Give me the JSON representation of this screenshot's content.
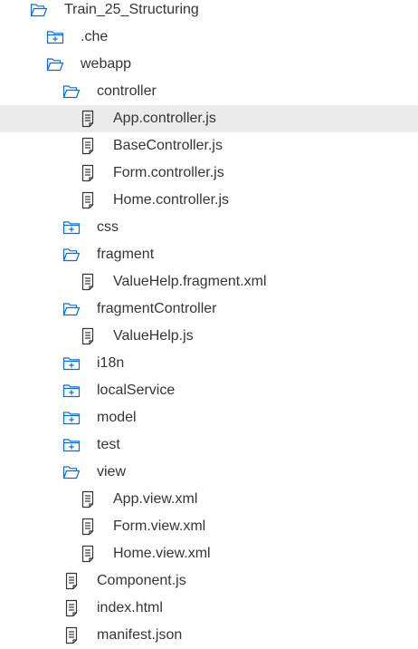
{
  "colors": {
    "icon": "#0a6ed1",
    "file_icon": "#32363a",
    "text": "#32363a",
    "selected_background": "#ebebeb"
  },
  "tree": [
    {
      "label": "Train_25_Structuring",
      "level": 0,
      "icon": "folder-open-icon"
    },
    {
      "label": ".che",
      "level": 1,
      "icon": "folder-closed-icon"
    },
    {
      "label": "webapp",
      "level": 1,
      "icon": "folder-open-icon"
    },
    {
      "label": "controller",
      "level": 2,
      "icon": "folder-open-icon"
    },
    {
      "label": "App.controller.js",
      "level": 3,
      "icon": "file-icon",
      "selected": true
    },
    {
      "label": "BaseController.js",
      "level": 3,
      "icon": "file-icon"
    },
    {
      "label": "Form.controller.js",
      "level": 3,
      "icon": "file-icon"
    },
    {
      "label": "Home.controller.js",
      "level": 3,
      "icon": "file-icon"
    },
    {
      "label": "css",
      "level": 2,
      "icon": "folder-closed-icon"
    },
    {
      "label": "fragment",
      "level": 2,
      "icon": "folder-open-icon"
    },
    {
      "label": "ValueHelp.fragment.xml",
      "level": 3,
      "icon": "file-icon"
    },
    {
      "label": "fragmentController",
      "level": 2,
      "icon": "folder-open-icon"
    },
    {
      "label": "ValueHelp.js",
      "level": 3,
      "icon": "file-icon"
    },
    {
      "label": "i18n",
      "level": 2,
      "icon": "folder-closed-icon"
    },
    {
      "label": "localService",
      "level": 2,
      "icon": "folder-closed-icon"
    },
    {
      "label": "model",
      "level": 2,
      "icon": "folder-closed-icon"
    },
    {
      "label": "test",
      "level": 2,
      "icon": "folder-closed-icon"
    },
    {
      "label": "view",
      "level": 2,
      "icon": "folder-open-icon"
    },
    {
      "label": "App.view.xml",
      "level": 3,
      "icon": "file-icon"
    },
    {
      "label": "Form.view.xml",
      "level": 3,
      "icon": "file-icon"
    },
    {
      "label": "Home.view.xml",
      "level": 3,
      "icon": "file-icon"
    },
    {
      "label": "Component.js",
      "level": 2,
      "icon": "file-icon"
    },
    {
      "label": "index.html",
      "level": 2,
      "icon": "file-icon"
    },
    {
      "label": "manifest.json",
      "level": 2,
      "icon": "file-icon"
    }
  ]
}
